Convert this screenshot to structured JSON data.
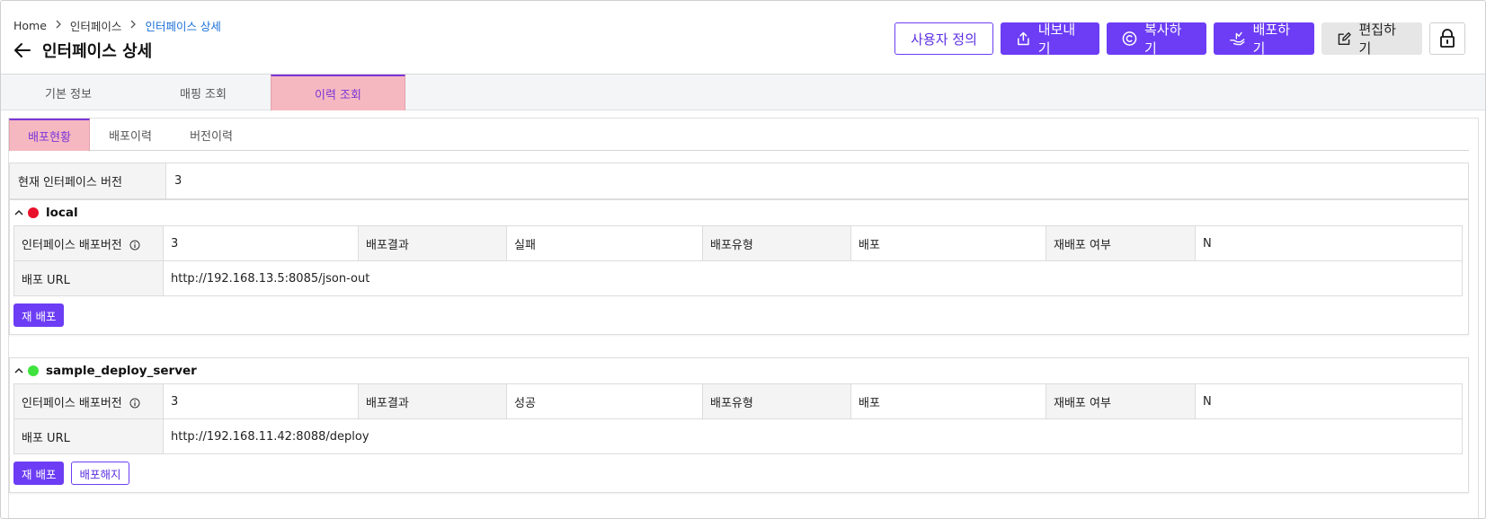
{
  "breadcrumb": {
    "home": "Home",
    "parent": "인터페이스",
    "current": "인터페이스 상세"
  },
  "page": {
    "title": "인터페이스 상세"
  },
  "actions": {
    "custom": "사용자 정의",
    "export": "내보내기",
    "copy": "복사하기",
    "deploy": "배포하기",
    "edit": "편집하기"
  },
  "main_tabs": [
    {
      "label": "기본 정보",
      "active": false
    },
    {
      "label": "매핑 조회",
      "active": false
    },
    {
      "label": "이력 조회",
      "active": true
    }
  ],
  "sub_tabs": [
    {
      "label": "배포현황",
      "active": true
    },
    {
      "label": "배포이력",
      "active": false
    },
    {
      "label": "버전이력",
      "active": false
    }
  ],
  "current_version": {
    "label": "현재 인터페이스 버전",
    "value": "3"
  },
  "labels": {
    "deploy_version": "인터페이스 배포버전",
    "deploy_result": "배포결과",
    "deploy_type": "배포유형",
    "redeploy_flag": "재배포 여부",
    "deploy_url": "배포 URL"
  },
  "servers": [
    {
      "name": "local",
      "status_color": "#e8102a",
      "version": "3",
      "result": "실패",
      "type": "배포",
      "redeploy": "N",
      "url": "http://192.168.13.5:8085/json-out",
      "buttons": {
        "redeploy": "재 배포"
      }
    },
    {
      "name": "sample_deploy_server",
      "status_color": "#3ee33e",
      "version": "3",
      "result": "성공",
      "type": "배포",
      "redeploy": "N",
      "url": "http://192.168.11.42:8088/deploy",
      "buttons": {
        "redeploy": "재 배포",
        "undeploy": "배포해지"
      }
    }
  ],
  "colors": {
    "accent": "#6c3df4",
    "active_tab_bg": "#f6b8c0",
    "link": "#1a6fd8"
  }
}
